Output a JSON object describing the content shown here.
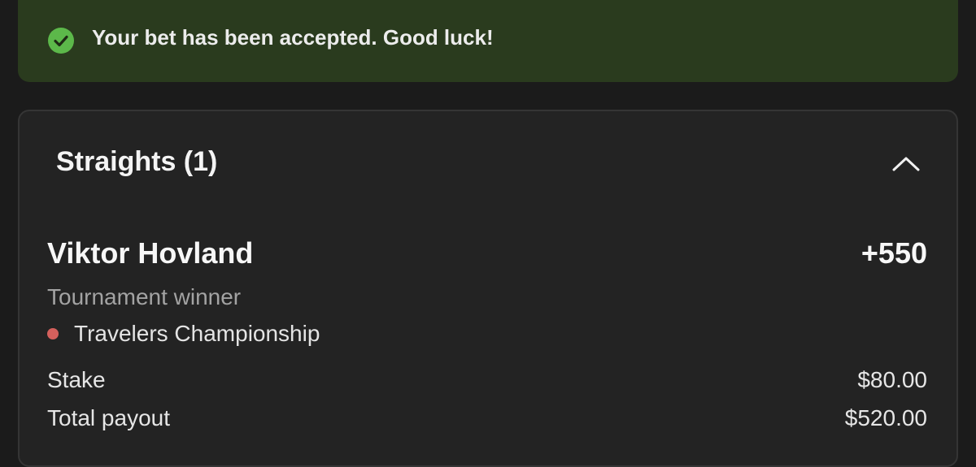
{
  "toast": {
    "icon": "checkmark-circle-icon",
    "icon_color": "#5cb84a",
    "background": "#2a3b1e",
    "message": "Your bet has been accepted. Good luck!"
  },
  "straights": {
    "title": "Straights (1)",
    "collapse_icon": "chevron-up-icon",
    "bet": {
      "selection": "Viktor Hovland",
      "odds": "+550",
      "market": "Tournament winner",
      "event_status_color": "#d4605c",
      "event": "Travelers Championship",
      "stake_label": "Stake",
      "stake_value": "$80.00",
      "payout_label": "Total payout",
      "payout_value": "$520.00"
    }
  }
}
